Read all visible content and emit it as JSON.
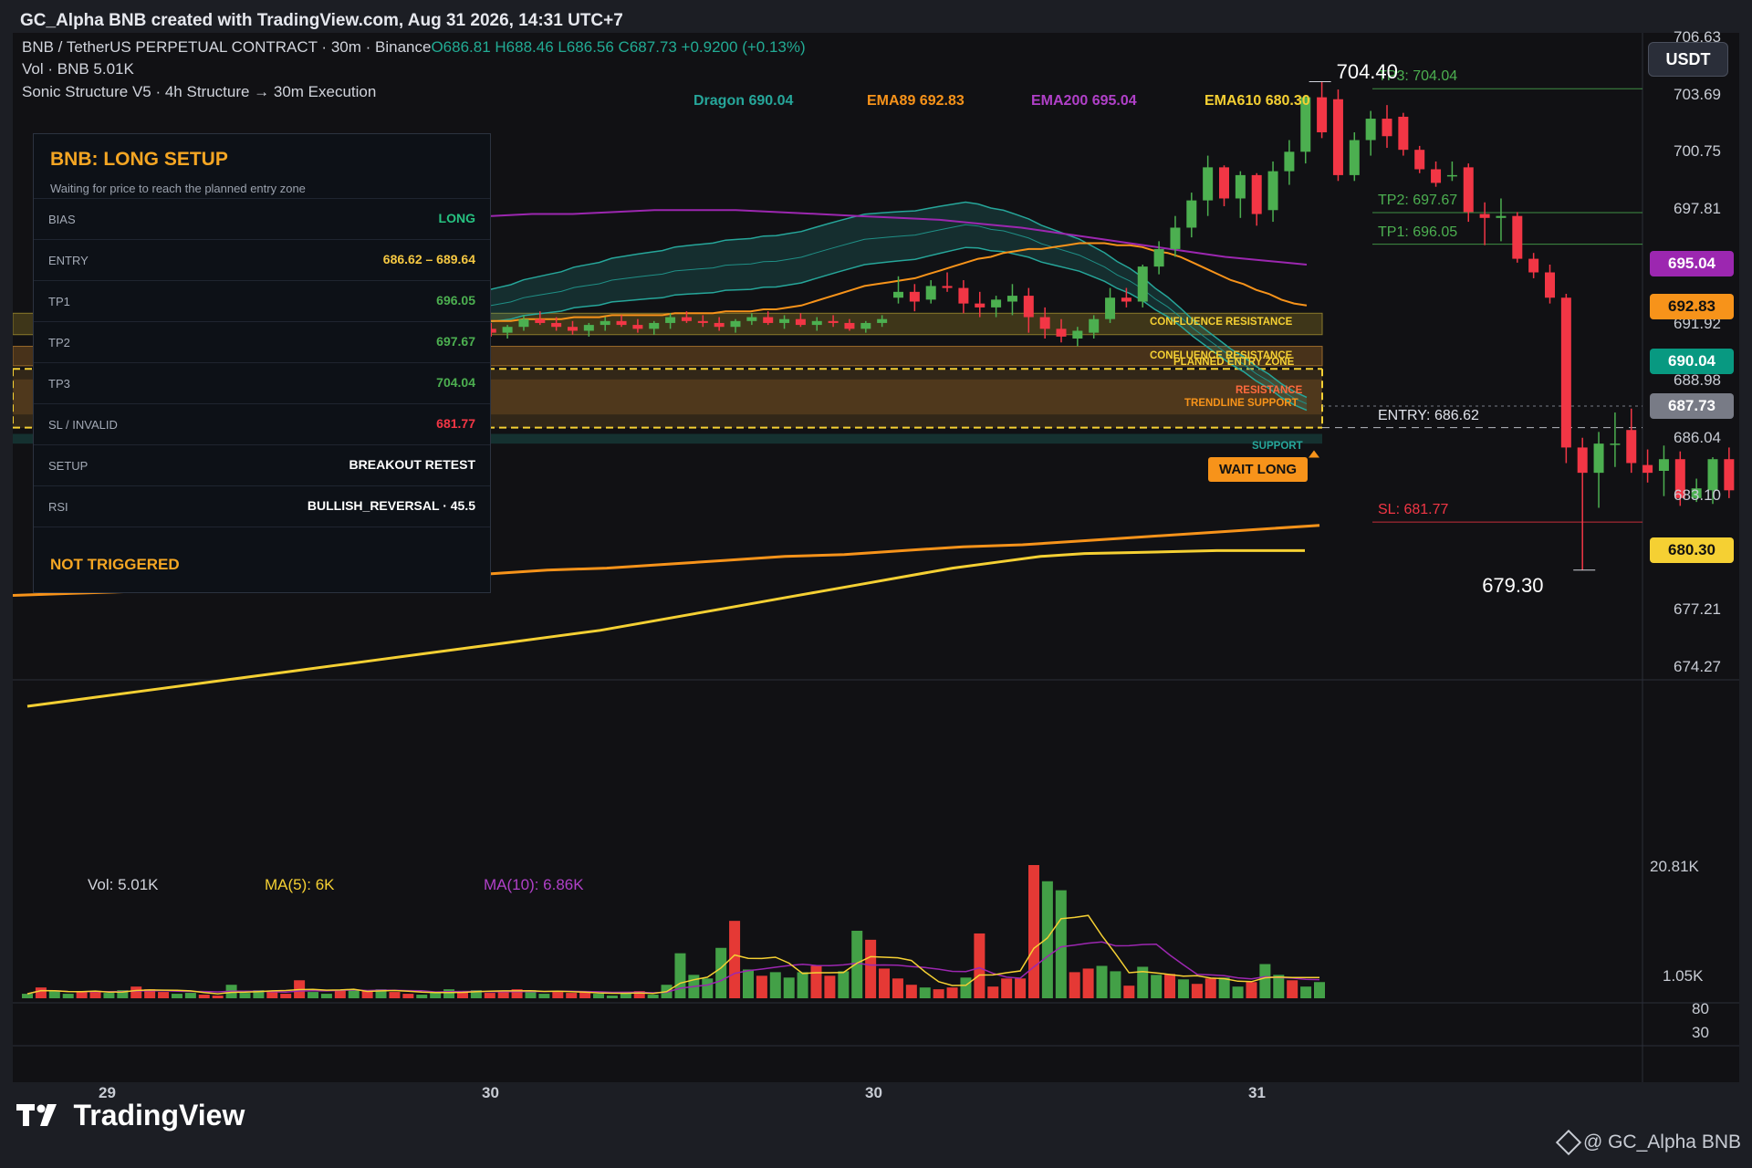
{
  "header": {
    "title": "GC_Alpha BNB created with TradingView.com, Aug 31 2026, 14:31 UTC+7"
  },
  "legend": {
    "symbol": "BNB / TetherUS PERPETUAL CONTRACT · 30m · Binance",
    "ohlc": "O686.81 H688.46 L686.56 C687.73 +0.9200 (+0.13%)",
    "vol": "Vol · BNB  5.01K",
    "indicator": "Sonic Structure V5 · 4h Structure → 30m Execution"
  },
  "indicator_labels": {
    "dragon": "Dragon 690.04",
    "ema89": "EMA89 692.83",
    "ema200": "EMA200 695.04",
    "ema610": "EMA610 680.30"
  },
  "currency_button": "USDT",
  "panel": {
    "title": "BNB: LONG SETUP",
    "subtitle": "Waiting for price to reach the planned entry zone",
    "rows": [
      {
        "key": "BIAS",
        "value": "LONG",
        "color": "#26c281"
      },
      {
        "key": "ENTRY",
        "value": "686.62 – 689.64",
        "color": "#f5c842"
      },
      {
        "key": "TP1",
        "value": "696.05",
        "color": "#4caf50"
      },
      {
        "key": "TP2",
        "value": "697.67",
        "color": "#4caf50"
      },
      {
        "key": "TP3",
        "value": "704.04",
        "color": "#4caf50"
      },
      {
        "key": "SL / INVALID",
        "value": "681.77",
        "color": "#f23645"
      },
      {
        "key": "SETUP",
        "value": "BREAKOUT RETEST",
        "color": "#ffffff"
      },
      {
        "key": "RSI",
        "value": "BULLISH_REVERSAL · 45.5",
        "color": "#ffffff"
      }
    ],
    "status": "NOT TRIGGERED"
  },
  "price_axis": {
    "labels": [
      "706.63",
      "703.69",
      "700.75",
      "697.81",
      "694.86",
      "691.92",
      "688.98",
      "686.04",
      "683.10",
      "680.15",
      "677.21",
      "674.27"
    ],
    "values": [
      706.63,
      703.69,
      700.75,
      697.81,
      694.86,
      691.92,
      688.98,
      686.04,
      683.1,
      680.15,
      677.21,
      674.27
    ]
  },
  "price_tags": [
    {
      "text": "695.04",
      "value": 695.04,
      "bg": "#9c27b0",
      "fg": "#ffffff"
    },
    {
      "text": "692.83",
      "value": 692.83,
      "bg": "#f7931a",
      "fg": "#111111"
    },
    {
      "text": "690.04",
      "value": 690.04,
      "bg": "#089981",
      "fg": "#ffffff"
    },
    {
      "text": "687.73",
      "value": 687.73,
      "bg": "#787b86",
      "fg": "#ffffff"
    },
    {
      "text": "680.30",
      "value": 680.3,
      "bg": "#f5d033",
      "fg": "#111111"
    }
  ],
  "levels": [
    {
      "text": "TP3: 704.04",
      "value": 704.04,
      "color": "#4caf50"
    },
    {
      "text": "TP2: 697.67",
      "value": 697.67,
      "color": "#4caf50"
    },
    {
      "text": "TP1: 696.05",
      "value": 696.05,
      "color": "#4caf50"
    },
    {
      "text": "ENTRY: 686.62",
      "value": 686.62,
      "color": "#e0e3eb"
    },
    {
      "text": "SL: 681.77",
      "value": 681.77,
      "color": "#f23645"
    }
  ],
  "zones": {
    "confluence_1": "CONFLUENCE RESISTANCE",
    "confluence_2": "CONFLUENCE RESISTANCE",
    "planned_entry": "PLANNED ENTRY ZONE",
    "resistance": "RESISTANCE",
    "trendline": "TRENDLINE SUPPORT",
    "support": "SUPPORT",
    "wait_long": "WAIT LONG"
  },
  "annotations": {
    "high": "704.40",
    "low": "679.30"
  },
  "volume": {
    "vol": "Vol: 5.01K",
    "ma5": "MA(5): 6K",
    "ma10": "MA(10): 6.86K",
    "axis_top": "20.81K",
    "axis_low": "1.05K",
    "rsi_80": "80",
    "rsi_30": "30"
  },
  "x_axis": [
    "29",
    "30",
    "30",
    "31"
  ],
  "brand": "TradingView",
  "credit": "@ GC_Alpha BNB",
  "chart_data": {
    "type": "candlestick",
    "ylim": [
      673.5,
      707.2
    ],
    "candles": [
      [
        691.6,
        691.9,
        691.3,
        691.7
      ],
      [
        691.7,
        692.1,
        691.4,
        691.5
      ],
      [
        691.5,
        692.0,
        691.2,
        691.8
      ],
      [
        691.8,
        692.3,
        691.5,
        692.0
      ],
      [
        692.0,
        692.2,
        691.6,
        691.7
      ],
      [
        691.7,
        692.0,
        691.3,
        691.5
      ],
      [
        691.5,
        691.9,
        691.2,
        691.8
      ],
      [
        691.8,
        692.4,
        691.6,
        692.2
      ],
      [
        692.2,
        692.6,
        691.9,
        692.0
      ],
      [
        692.0,
        692.3,
        691.6,
        691.8
      ],
      [
        691.8,
        692.1,
        691.4,
        691.6
      ],
      [
        691.6,
        692.0,
        691.3,
        691.9
      ],
      [
        691.9,
        692.3,
        691.6,
        692.1
      ],
      [
        692.1,
        692.4,
        691.8,
        691.9
      ],
      [
        691.9,
        692.2,
        691.5,
        691.7
      ],
      [
        691.7,
        692.1,
        691.4,
        692.0
      ],
      [
        692.0,
        692.5,
        691.7,
        692.3
      ],
      [
        692.3,
        692.6,
        692.0,
        692.1
      ],
      [
        692.1,
        692.4,
        691.8,
        692.0
      ],
      [
        692.0,
        692.3,
        691.6,
        691.8
      ],
      [
        691.8,
        692.2,
        691.5,
        692.1
      ],
      [
        692.1,
        692.5,
        691.9,
        692.3
      ],
      [
        692.3,
        692.6,
        691.9,
        692.0
      ],
      [
        692.0,
        692.4,
        691.7,
        692.2
      ],
      [
        692.2,
        692.5,
        691.8,
        691.9
      ],
      [
        691.9,
        692.3,
        691.6,
        692.1
      ],
      [
        692.1,
        692.4,
        691.8,
        692.0
      ],
      [
        692.0,
        692.2,
        691.6,
        691.7
      ],
      [
        691.7,
        692.1,
        691.5,
        692.0
      ],
      [
        692.0,
        692.4,
        691.8,
        692.2
      ],
      [
        693.3,
        694.4,
        693.0,
        693.6
      ],
      [
        693.6,
        694.0,
        692.6,
        693.1
      ],
      [
        693.2,
        694.2,
        693.0,
        693.9
      ],
      [
        693.9,
        694.6,
        693.6,
        693.8
      ],
      [
        693.8,
        694.2,
        692.5,
        693.0
      ],
      [
        693.0,
        693.6,
        692.3,
        692.8
      ],
      [
        692.8,
        693.4,
        692.3,
        693.2
      ],
      [
        693.1,
        694.0,
        692.4,
        693.4
      ],
      [
        693.4,
        693.8,
        691.5,
        692.3
      ],
      [
        692.3,
        692.8,
        691.2,
        691.7
      ],
      [
        691.7,
        692.2,
        691.0,
        691.3
      ],
      [
        691.2,
        691.8,
        690.8,
        691.6
      ],
      [
        691.5,
        692.4,
        691.2,
        692.2
      ],
      [
        692.2,
        693.8,
        692.0,
        693.3
      ],
      [
        693.3,
        693.8,
        692.8,
        693.1
      ],
      [
        693.1,
        695.0,
        692.8,
        694.9
      ],
      [
        694.9,
        696.2,
        694.5,
        695.8
      ],
      [
        695.8,
        697.5,
        695.4,
        696.9
      ],
      [
        696.9,
        698.7,
        696.4,
        698.3
      ],
      [
        698.3,
        700.6,
        697.5,
        700.0
      ],
      [
        700.0,
        700.1,
        698.0,
        698.4
      ],
      [
        698.4,
        699.8,
        697.4,
        699.6
      ],
      [
        699.6,
        699.7,
        697.0,
        697.6
      ],
      [
        697.8,
        700.3,
        697.2,
        699.8
      ],
      [
        699.8,
        701.4,
        699.1,
        700.8
      ],
      [
        700.8,
        703.7,
        700.2,
        703.6
      ],
      [
        703.6,
        704.4,
        701.5,
        701.8
      ],
      [
        703.5,
        704.0,
        699.3,
        699.6
      ],
      [
        699.6,
        701.8,
        699.3,
        701.4
      ],
      [
        701.4,
        702.9,
        700.6,
        702.5
      ],
      [
        702.5,
        703.2,
        701.0,
        701.6
      ],
      [
        702.6,
        702.8,
        700.6,
        700.9
      ],
      [
        700.9,
        701.1,
        699.7,
        699.9
      ],
      [
        699.9,
        700.3,
        699.0,
        699.2
      ],
      [
        699.6,
        700.3,
        699.3,
        699.6
      ],
      [
        700.0,
        700.2,
        697.2,
        697.7
      ],
      [
        697.6,
        698.2,
        696.0,
        697.4
      ],
      [
        697.4,
        698.4,
        696.2,
        697.5
      ],
      [
        697.5,
        697.7,
        695.1,
        695.3
      ],
      [
        695.3,
        695.6,
        694.3,
        694.6
      ],
      [
        694.6,
        695.0,
        693.0,
        693.3
      ],
      [
        693.3,
        693.5,
        684.8,
        685.6
      ],
      [
        685.6,
        686.1,
        679.3,
        684.3
      ],
      [
        684.3,
        686.4,
        682.5,
        685.8
      ],
      [
        685.8,
        687.4,
        684.6,
        685.8
      ],
      [
        686.5,
        687.6,
        684.3,
        684.8
      ],
      [
        684.7,
        685.5,
        683.8,
        684.3
      ],
      [
        684.4,
        685.7,
        683.1,
        685.0
      ],
      [
        685.0,
        685.4,
        682.6,
        683.0
      ],
      [
        683.0,
        684.0,
        682.8,
        683.5
      ],
      [
        683.4,
        685.1,
        682.7,
        685.0
      ],
      [
        685.0,
        685.6,
        683.0,
        683.4
      ],
      [
        683.4,
        685.6,
        683.2,
        685.4
      ],
      [
        685.3,
        686.3,
        684.3,
        685.0
      ],
      [
        685.0,
        685.5,
        683.2,
        683.6
      ],
      [
        683.2,
        684.5,
        683.0,
        684.2
      ],
      [
        684.2,
        686.8,
        684.0,
        686.5
      ],
      [
        686.5,
        687.0,
        685.6,
        686.1
      ],
      [
        686.1,
        686.8,
        685.6,
        686.4
      ],
      [
        686.4,
        687.3,
        686.2,
        686.8
      ],
      [
        686.8,
        687.1,
        685.9,
        686.2
      ],
      [
        686.2,
        686.8,
        685.9,
        686.7
      ],
      [
        686.7,
        688.5,
        686.5,
        687.7
      ]
    ],
    "volumes": [
      0.5,
      1.2,
      0.8,
      0.5,
      0.7,
      0.8,
      0.6,
      0.9,
      1.3,
      1.0,
      0.7,
      0.5,
      0.6,
      0.4,
      0.3,
      1.5,
      0.6,
      0.9,
      0.8,
      0.5,
      2.0,
      0.7,
      0.5,
      0.9,
      0.9,
      0.8,
      1.0,
      0.7,
      0.5,
      0.4,
      0.6,
      1.0,
      0.8,
      0.9,
      0.6,
      0.8,
      1.0,
      0.9,
      0.5,
      0.7,
      0.6,
      0.7,
      0.5,
      0.3,
      0.7,
      0.8,
      0.4,
      1.5,
      5.0,
      2.6,
      2.2,
      5.6,
      8.6,
      3.2,
      2.5,
      2.9,
      2.3,
      2.9,
      3.6,
      2.5,
      3.0,
      7.5,
      6.5,
      3.3,
      2.2,
      1.5,
      1.2,
      1.0,
      1.2,
      2.3,
      7.2,
      1.3,
      2.2,
      2.2,
      14.8,
      13.0,
      12.0,
      2.9,
      3.3,
      3.6,
      3.0,
      1.4,
      3.5,
      2.6,
      2.7,
      2.1,
      1.6,
      2.2,
      2.3,
      1.3,
      1.8,
      3.8,
      2.6,
      2.0,
      1.3,
      1.8
    ],
    "ema89": [
      692.0,
      692.0,
      692.0,
      692.0,
      692.0,
      692.0,
      692.1,
      692.1,
      692.1,
      692.2,
      692.2,
      692.2,
      692.2,
      692.3,
      692.3,
      692.3,
      692.4,
      692.4,
      692.4,
      692.4,
      692.4,
      692.5,
      692.5,
      692.5,
      692.5,
      692.6,
      692.6,
      692.6,
      692.7,
      692.7,
      692.8,
      692.9,
      693.1,
      693.3,
      693.5,
      693.7,
      693.9,
      694.0,
      694.1,
      694.2,
      694.3,
      694.5,
      694.7,
      694.9,
      695.1,
      695.3,
      695.4,
      695.6,
      695.7,
      695.8,
      695.8,
      695.9,
      696.0,
      696.1,
      696.1,
      696.1,
      696.0,
      696.0,
      695.9,
      695.7,
      695.6,
      695.4,
      695.1,
      694.8,
      694.5,
      694.2,
      694.0,
      693.7,
      693.5,
      693.2,
      693.0,
      692.9
    ],
    "ema200": [
      697.3,
      697.4,
      697.5,
      697.6,
      697.6,
      697.7,
      697.8,
      697.8,
      697.8,
      697.7,
      697.6,
      697.5,
      697.4,
      697.3,
      697.1,
      696.9,
      696.6,
      696.3,
      696.0,
      695.7,
      695.4,
      695.2,
      695.0
    ],
    "ema610": [
      685.9,
      686.0,
      686.1,
      686.3,
      686.4,
      686.6,
      686.7,
      686.9,
      687.0,
      687.2,
      687.3,
      687.5,
      687.7,
      687.9,
      688.0,
      688.2,
      688.4,
      688.5,
      688.7,
      688.9,
      689.1,
      689.3,
      689.5
    ],
    "ema_long": [
      672.3,
      672.6,
      672.9,
      673.2,
      673.5,
      673.8,
      674.1,
      674.4,
      674.7,
      675.0,
      675.3,
      675.6,
      675.9,
      676.2,
      676.6,
      677.0,
      677.4,
      677.8,
      678.2,
      678.6,
      679.0,
      679.4,
      679.7,
      680.0,
      680.15,
      680.2,
      680.25,
      680.3,
      680.3,
      680.3
    ]
  }
}
